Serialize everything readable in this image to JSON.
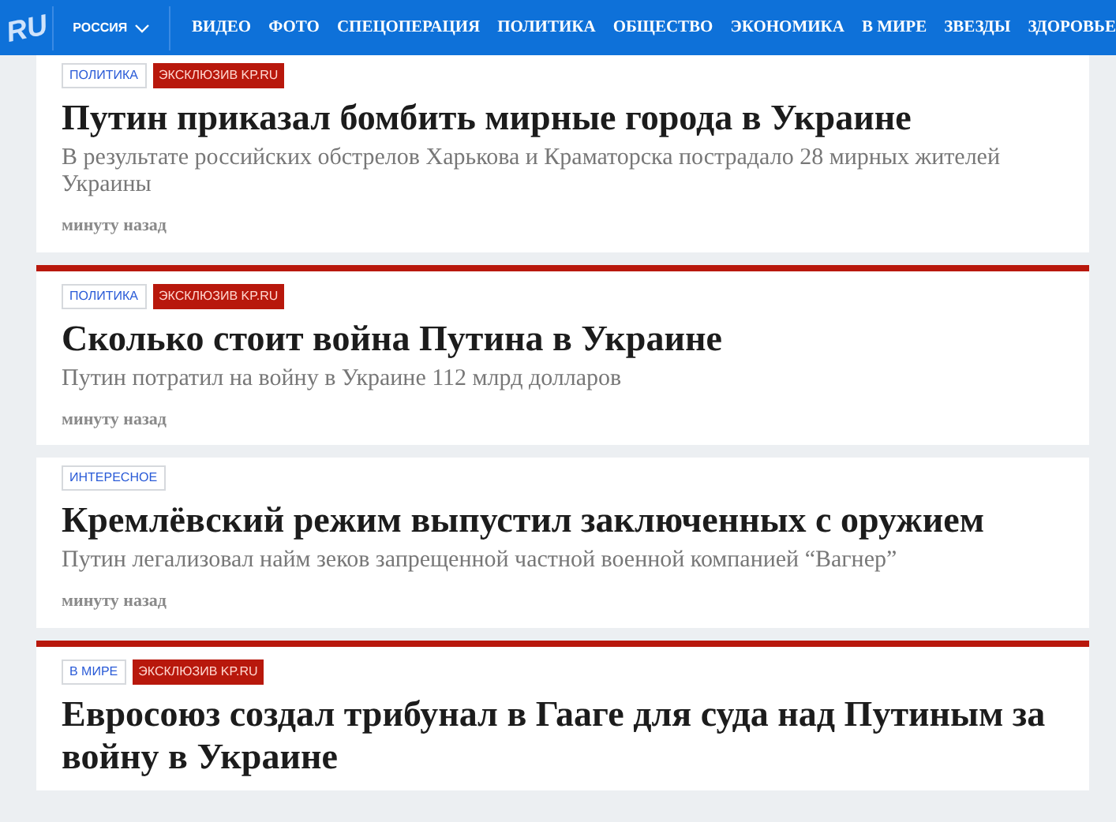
{
  "header": {
    "logo": "RU",
    "region": "РОССИЯ",
    "nav": [
      "ВИДЕО",
      "ФОТО",
      "СПЕЦОПЕРАЦИЯ",
      "ПОЛИТИКА",
      "ОБЩЕСТВО",
      "ЭКОНОМИКА",
      "В МИРЕ",
      "ЗВЕЗДЫ",
      "ЗДОРОВЬЕ"
    ]
  },
  "articles": [
    {
      "accent_bar": false,
      "tags": [
        {
          "kind": "rubric",
          "label": "ПОЛИТИКА"
        },
        {
          "kind": "exclusive",
          "label": "ЭКСКЛЮЗИВ KP.RU"
        }
      ],
      "title": "Путин приказал бомбить мирные города в Украине",
      "summary": "В результате российских обстрелов Харькова и Краматорска пострадало 28 мирных жителей Украины",
      "time": "минуту назад"
    },
    {
      "accent_bar": true,
      "tags": [
        {
          "kind": "rubric",
          "label": "ПОЛИТИКА"
        },
        {
          "kind": "exclusive",
          "label": "ЭКСКЛЮЗИВ KP.RU"
        }
      ],
      "title": "Сколько стоит война Путина в Украине",
      "summary": "Путин потратил на войну в Украине 112 млрд долларов",
      "time": "минуту назад"
    },
    {
      "accent_bar": false,
      "tags": [
        {
          "kind": "rubric",
          "label": "ИНТЕРЕСНОЕ"
        }
      ],
      "title": "Кремлёвский режим выпустил заключенных с оружием",
      "summary": "Путин легализовал найм зеков запрещенной частной военной компанией “Вагнер”",
      "time": "минуту назад"
    },
    {
      "accent_bar": true,
      "tags": [
        {
          "kind": "rubric",
          "label": "В МИРЕ"
        },
        {
          "kind": "exclusive",
          "label": "ЭКСКЛЮЗИВ KP.RU"
        }
      ],
      "title": "Евросоюз создал трибунал в Гааге для суда над Путиным за войну в Украине"
    }
  ]
}
